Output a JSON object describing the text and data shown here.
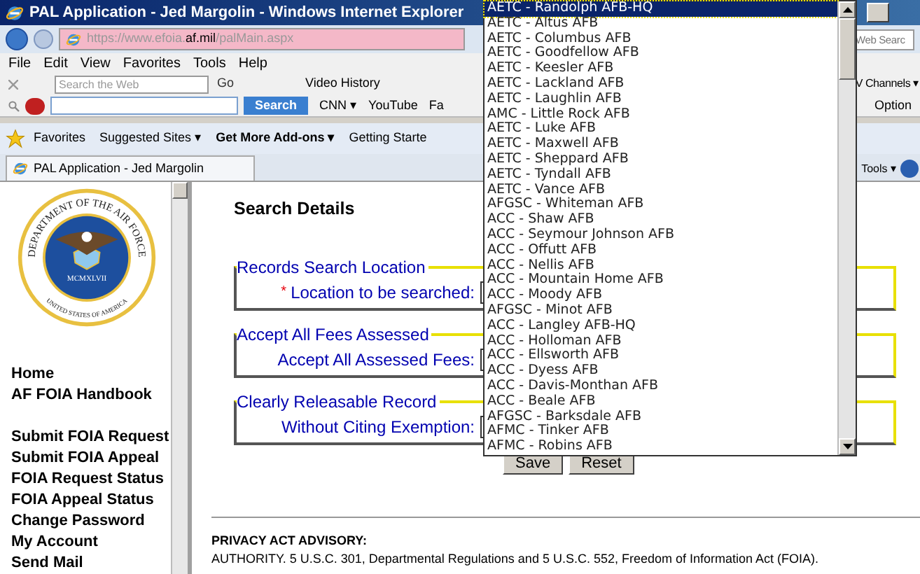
{
  "window": {
    "title": "PAL Application - Jed Margolin - Windows Internet Explorer"
  },
  "address_bar": {
    "url_prefix": "https://www.efoia.",
    "url_domain": "af.mil",
    "url_path": "/palMain.aspx",
    "web_search_placeholder": "Web Searc"
  },
  "menu": [
    "File",
    "Edit",
    "View",
    "Favorites",
    "Tools",
    "Help"
  ],
  "toolbar": {
    "search_placeholder": "Search the Web",
    "go": "Go",
    "video_history": "Video History",
    "channels": "V Channels ▾"
  },
  "search_toolbar": {
    "search_button": "Search",
    "links": [
      {
        "label": "CNN ▾"
      },
      {
        "label": "YouTube"
      },
      {
        "label": "Fa"
      }
    ],
    "options": "Option"
  },
  "favorites_bar": {
    "favorites": "Favorites",
    "links": [
      {
        "label": "Suggested Sites ▾",
        "bold": false
      },
      {
        "label": "Get More Add-ons ▾",
        "bold": true
      },
      {
        "label": "Getting Starte",
        "bold": false
      }
    ]
  },
  "tabs": [
    {
      "label": "PAL Application - Jed Margolin",
      "selected": true
    }
  ],
  "command_bar": {
    "tools": "Tools ▾"
  },
  "seal": {
    "top_text": "DEPARTMENT OF THE AIR FORCE",
    "bottom_text": "UNITED STATES OF AMERICA",
    "year": "MCMXLVII"
  },
  "nav_groups": [
    [
      "Home",
      "AF FOIA Handbook"
    ],
    [
      "Submit FOIA Request",
      "Submit FOIA Appeal",
      "FOIA Request Status",
      "FOIA Appeal Status",
      "Change Password",
      "My Account",
      "Send Mail"
    ]
  ],
  "heading": "Search Details",
  "fieldsets": [
    {
      "legend": "Records Search Location",
      "label": "Location to be searched:",
      "required": true
    },
    {
      "legend": "Accept All Fees Assessed",
      "label": "Accept All Assessed Fees:",
      "required": false
    },
    {
      "legend": "Clearly Releasable Record",
      "label": "Without Citing Exemption:",
      "required": false
    }
  ],
  "required_mark": "*",
  "buttons": [
    "Save",
    "Reset"
  ],
  "advisory": {
    "title": "PRIVACY ACT ADVISORY:",
    "text": "AUTHORITY. 5 U.S.C. 301, Departmental Regulations and 5 U.S.C. 552, Freedom of Information Act (FOIA)."
  },
  "dropdown": {
    "options": [
      {
        "label": "AETC - Randolph AFB-HQ",
        "selected": true
      },
      {
        "label": "AETC - Altus AFB",
        "selected": false
      },
      {
        "label": "AETC - Columbus AFB",
        "selected": false
      },
      {
        "label": "AETC - Goodfellow AFB",
        "selected": false
      },
      {
        "label": "AETC - Keesler AFB",
        "selected": false
      },
      {
        "label": "AETC - Lackland AFB",
        "selected": false
      },
      {
        "label": "AETC - Laughlin AFB",
        "selected": false
      },
      {
        "label": "AMC - Little Rock AFB",
        "selected": false
      },
      {
        "label": "AETC - Luke AFB",
        "selected": false
      },
      {
        "label": "AETC - Maxwell AFB",
        "selected": false
      },
      {
        "label": "AETC - Sheppard AFB",
        "selected": false
      },
      {
        "label": "AETC - Tyndall AFB",
        "selected": false
      },
      {
        "label": "AETC - Vance AFB",
        "selected": false
      },
      {
        "label": "AFGSC - Whiteman AFB",
        "selected": false
      },
      {
        "label": "ACC - Shaw AFB",
        "selected": false
      },
      {
        "label": "ACC - Seymour Johnson AFB",
        "selected": false
      },
      {
        "label": "ACC - Offutt AFB",
        "selected": false
      },
      {
        "label": "ACC - Nellis AFB",
        "selected": false
      },
      {
        "label": "ACC - Mountain Home AFB",
        "selected": false
      },
      {
        "label": "ACC - Moody AFB",
        "selected": false
      },
      {
        "label": "AFGSC - Minot AFB",
        "selected": false
      },
      {
        "label": "ACC - Langley AFB-HQ",
        "selected": false
      },
      {
        "label": "ACC - Holloman AFB",
        "selected": false
      },
      {
        "label": "ACC - Ellsworth AFB",
        "selected": false
      },
      {
        "label": "ACC - Dyess AFB",
        "selected": false
      },
      {
        "label": "ACC - Davis-Monthan AFB",
        "selected": false
      },
      {
        "label": "ACC - Beale AFB",
        "selected": false
      },
      {
        "label": "AFGSC - Barksdale AFB",
        "selected": false
      },
      {
        "label": "AFMC - Tinker AFB",
        "selected": false
      },
      {
        "label": "AFMC - Robins AFB",
        "selected": false
      }
    ]
  }
}
